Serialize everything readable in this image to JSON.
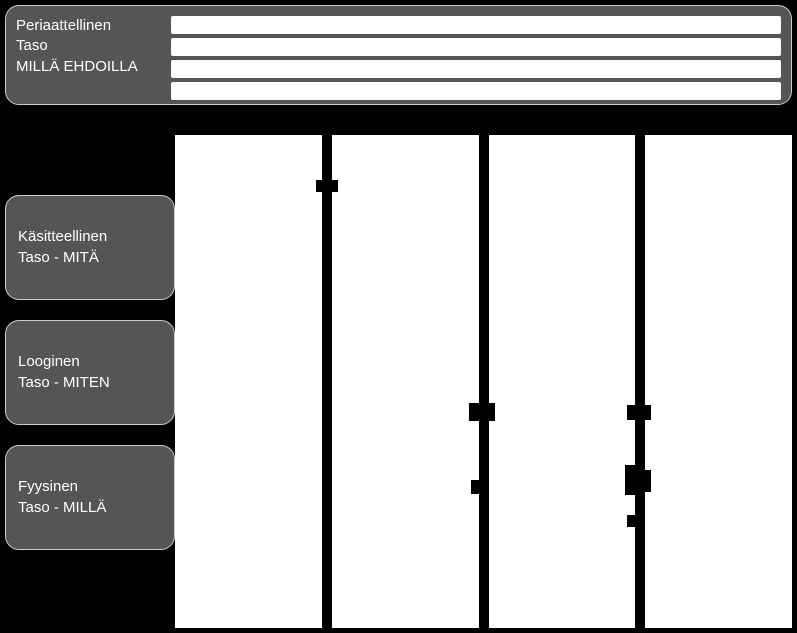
{
  "top": {
    "line1": "Periaattellinen",
    "line2": "Taso",
    "line3": "MILLÄ EHDOILLA"
  },
  "levels": [
    {
      "line1": "Käsitteellinen",
      "line2": "Taso - MITÄ"
    },
    {
      "line1": "Looginen",
      "line2": "Taso - MITEN"
    },
    {
      "line1": "Fyysinen",
      "line2": "Taso - MILLÄ"
    }
  ],
  "columns": 4,
  "top_bars": 4
}
